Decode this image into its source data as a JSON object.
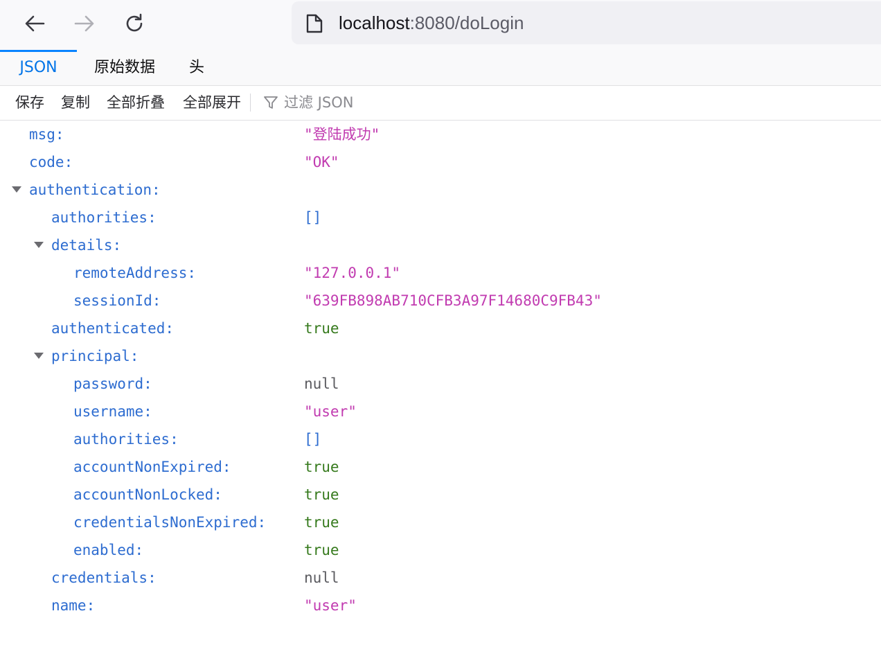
{
  "browser": {
    "url_host": "localhost",
    "url_rest": ":8080/doLogin",
    "icons": [
      "back-arrow-icon",
      "forward-arrow-icon",
      "reload-icon",
      "page-icon"
    ]
  },
  "viewer": {
    "tabs": [
      {
        "label": "JSON",
        "selected": true
      },
      {
        "label": "原始数据",
        "selected": false
      },
      {
        "label": "头",
        "selected": false
      }
    ],
    "actions": {
      "save": "保存",
      "copy": "复制",
      "collapse_all": "全部折叠",
      "expand_all": "全部展开",
      "filter_placeholder": "过滤 JSON"
    },
    "colors": {
      "key": "#2d6cd0",
      "string": "#c13bb0",
      "boolean": "#367a1d",
      "null": "#5a5a5f",
      "accent": "#0a84ff"
    }
  },
  "json_rows": [
    {
      "key": "msg:",
      "value": "\"登陆成功\"",
      "type": "string"
    },
    {
      "key": "code:",
      "value": "\"OK\"",
      "type": "string"
    },
    {
      "key": "authentication:",
      "value": "",
      "type": "object"
    },
    {
      "key": "authorities:",
      "value": "[]",
      "type": "array"
    },
    {
      "key": "details:",
      "value": "",
      "type": "object"
    },
    {
      "key": "remoteAddress:",
      "value": "\"127.0.0.1\"",
      "type": "string"
    },
    {
      "key": "sessionId:",
      "value": "\"639FB898AB710CFB3A97F14680C9FB43\"",
      "type": "string"
    },
    {
      "key": "authenticated:",
      "value": "true",
      "type": "bool"
    },
    {
      "key": "principal:",
      "value": "",
      "type": "object"
    },
    {
      "key": "password:",
      "value": "null",
      "type": "null"
    },
    {
      "key": "username:",
      "value": "\"user\"",
      "type": "string"
    },
    {
      "key": "authorities:",
      "value": "[]",
      "type": "array"
    },
    {
      "key": "accountNonExpired:",
      "value": "true",
      "type": "bool"
    },
    {
      "key": "accountNonLocked:",
      "value": "true",
      "type": "bool"
    },
    {
      "key": "credentialsNonExpired:",
      "value": "true",
      "type": "bool"
    },
    {
      "key": "enabled:",
      "value": "true",
      "type": "bool"
    },
    {
      "key": "credentials:",
      "value": "null",
      "type": "null"
    },
    {
      "key": "name:",
      "value": "\"user\"",
      "type": "string"
    }
  ]
}
